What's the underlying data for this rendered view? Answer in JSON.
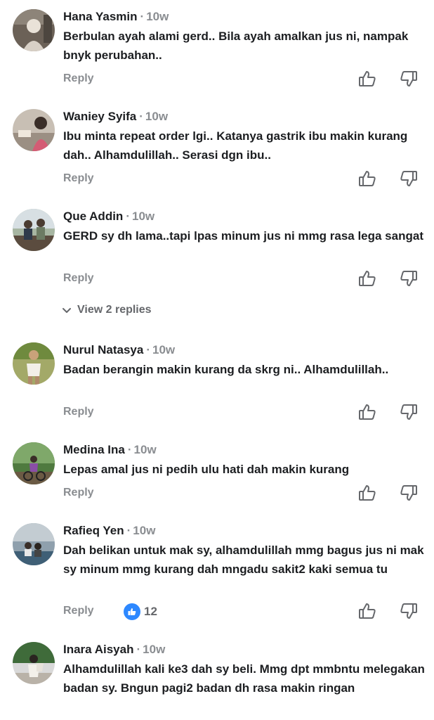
{
  "comments": [
    {
      "name": "Hana Yasmin",
      "time": "10w",
      "text": "Berbulan ayah alami gerd.. Bila ayah amalkan jus ni, nampak bnyk perubahan..",
      "reply": "Reply"
    },
    {
      "name": "Waniey Syifa",
      "time": "10w",
      "text": "Ibu minta repeat order lgi.. Katanya gastrik ibu makin kurang dah.. Alhamdulillah.. Serasi dgn ibu..",
      "reply": "Reply"
    },
    {
      "name": "Que Addin",
      "time": "10w",
      "text": "GERD sy dh lama..tapi lpas minum jus ni mmg rasa lega sangat",
      "reply": "Reply",
      "view_replies": "View 2 replies"
    },
    {
      "name": "Nurul Natasya",
      "time": "10w",
      "text": "Badan berangin makin kurang da skrg ni.. Alhamdulillah..",
      "reply": "Reply"
    },
    {
      "name": "Medina Ina",
      "time": "10w",
      "text": "Lepas amal jus ni pedih ulu hati dah makin kurang",
      "reply": "Reply"
    },
    {
      "name": "Rafieq Yen",
      "time": "10w",
      "text": "Dah belikan untuk mak sy, alhamdulillah mmg bagus jus ni mak sy minum mmg kurang dah mngadu sakit2 kaki semua tu",
      "reply": "Reply",
      "reaction_count": "12"
    },
    {
      "name": "Inara Aisyah",
      "time": "10w",
      "text": "Alhamdulillah kali ke3 dah sy beli. Mmg dpt mmbntu melegakan badan sy. Bngun pagi2 badan dh rasa makin ringan"
    }
  ],
  "separator": "·",
  "icons": {
    "like": "thumbs-up-icon",
    "dislike": "thumbs-down-icon",
    "expand": "chevron-down-icon",
    "reaction": "like-reaction-icon"
  },
  "colors": {
    "text": "#1c1e21",
    "muted": "#8a8d91",
    "reaction_blue": "#2d88ff"
  }
}
